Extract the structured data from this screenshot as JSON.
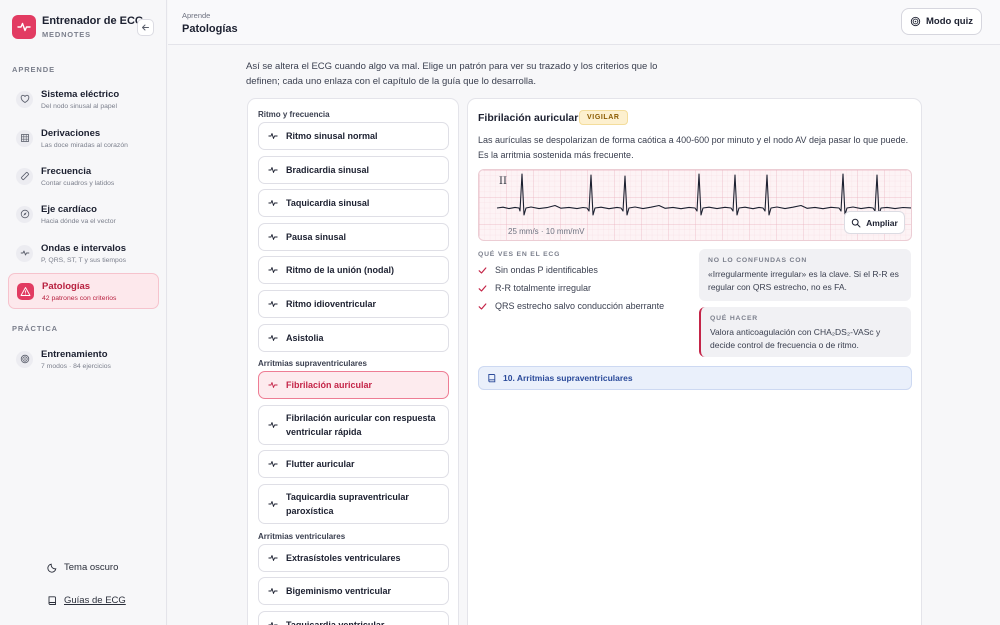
{
  "brand": {
    "title": "Entrenador de ECG",
    "subtitle": "MEDNOTES"
  },
  "sidebar": {
    "section_learn": "APRENDE",
    "section_practice": "PRÁCTICA",
    "items": [
      {
        "label": "Sistema eléctrico",
        "sub": "Del nodo sinusal al papel",
        "icon": "heart-icon"
      },
      {
        "label": "Derivaciones",
        "sub": "Las doce miradas al corazón",
        "icon": "grid-icon"
      },
      {
        "label": "Frecuencia",
        "sub": "Contar cuadros y latidos",
        "icon": "ruler-icon"
      },
      {
        "label": "Eje cardíaco",
        "sub": "Hacia dónde va el vector",
        "icon": "compass-icon"
      },
      {
        "label": "Ondas e intervalos",
        "sub": "P, QRS, ST, T y sus tiempos",
        "icon": "wave-icon"
      },
      {
        "label": "Patologías",
        "sub": "42 patrones con criterios",
        "icon": "warning-icon",
        "active": true
      }
    ],
    "practice_items": [
      {
        "label": "Entrenamiento",
        "sub": "7 modos · 84 ejercicios",
        "icon": "target-icon"
      }
    ],
    "theme_toggle": "Tema oscuro",
    "guides_link": "Guías de ECG"
  },
  "header": {
    "breadcrumb": "Aprende",
    "title": "Patologías",
    "quiz_button": "Modo quiz"
  },
  "intro": "Así se altera el ECG cuando algo va mal. Elige un patrón para ver su trazado y los criterios que lo definen; cada uno enlaza con el capítulo de la guía que lo desarrolla.",
  "list": {
    "groups": [
      {
        "label": "Ritmo y frecuencia",
        "items": [
          "Ritmo sinusal normal",
          "Bradicardia sinusal",
          "Taquicardia sinusal",
          "Pausa sinusal",
          "Ritmo de la unión (nodal)",
          "Ritmo idioventricular",
          "Asistolia"
        ]
      },
      {
        "label": "Arritmias supraventriculares",
        "items": [
          "Fibrilación auricular",
          "Fibrilación auricular con respuesta ventricular rápida",
          "Flutter auricular",
          "Taquicardia supraventricular paroxística"
        ]
      },
      {
        "label": "Arritmias ventriculares",
        "items": [
          "Extrasístoles ventriculares",
          "Bigeminismo ventricular",
          "Taquicardia ventricular"
        ]
      }
    ],
    "selected": "Fibrilación auricular"
  },
  "detail": {
    "title": "Fibrilación auricular",
    "badge": "VIGILAR",
    "description": "Las aurículas se despolarizan de forma caótica a 400-600 por minuto y el nodo AV deja pasar lo que puede. Es la arritmia sostenida más frecuente.",
    "ecg": {
      "lead": "II",
      "scale": "25 mm/s · 10 mm/mV",
      "zoom_button": "Ampliar"
    },
    "criteria_label": "QUÉ VES EN EL ECG",
    "criteria": [
      "Sin ondas P identificables",
      "R-R totalmente irregular",
      "QRS estrecho salvo conducción aberrante"
    ],
    "confuse_label": "NO LO CONFUNDAS CON",
    "confuse_text": "«Irregularmente irregular» es la clave. Si el R-R es regular con QRS estrecho, no es FA.",
    "action_label": "QUÉ HACER",
    "action_text": "Valora anticoagulación con CHA₂DS₂-VASc y decide control de frecuencia o de ritmo.",
    "chapter_link": "10. Arritmias supraventriculares"
  },
  "colors": {
    "accent": "#e23b62",
    "badge_bg": "#fdf0cf",
    "link_bg": "#eaf0fb"
  }
}
